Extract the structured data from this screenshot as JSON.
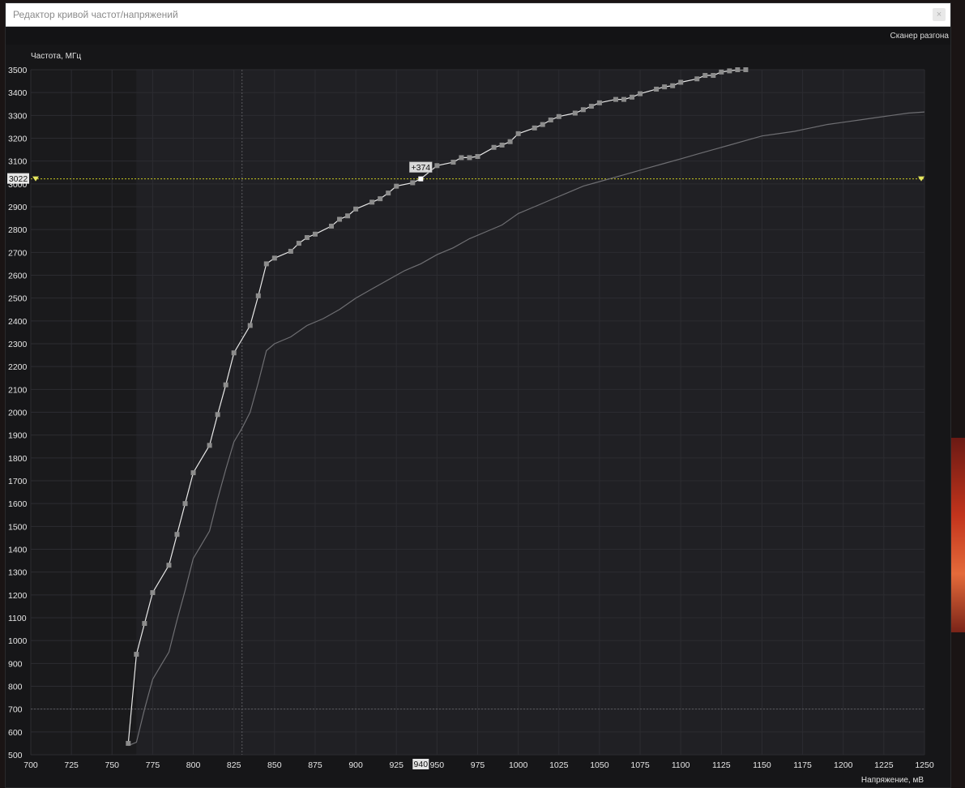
{
  "window": {
    "title": "Редактор кривой частот/напряжений",
    "close_label": "×"
  },
  "toolbar": {
    "scanner_label": "Сканер разгона"
  },
  "chart_data": {
    "type": "line",
    "ylabel": "Частота, МГц",
    "xlabel": "Напряжение, мВ",
    "xlim": [
      700,
      1250
    ],
    "ylim": [
      500,
      3500
    ],
    "x_ticks": [
      700,
      725,
      750,
      775,
      800,
      825,
      850,
      875,
      900,
      925,
      950,
      975,
      1000,
      1025,
      1050,
      1075,
      1100,
      1125,
      1150,
      1175,
      1200,
      1225,
      1250
    ],
    "y_ticks": [
      500,
      600,
      700,
      800,
      900,
      1000,
      1100,
      1200,
      1300,
      1400,
      1500,
      1600,
      1700,
      1800,
      1900,
      2000,
      2100,
      2200,
      2300,
      2400,
      2500,
      2600,
      2700,
      2800,
      2900,
      3000,
      3100,
      3200,
      3300,
      3400,
      3500
    ],
    "grid": true,
    "locked_region_x_max": 765,
    "reference_line_x": 830,
    "reference_line_y": 700,
    "current_frequency": 3022,
    "current_frequency_label": "3022",
    "selected_voltage": 940,
    "selected_voltage_label": "940",
    "offset_label": "+374",
    "colors": {
      "edited_curve": "#e8e8e8",
      "default_curve": "#6e6e72",
      "markers": "#8c8c8c",
      "selected_marker": "#ffffff",
      "frequency_line": "#c8c820",
      "plot_bg": "#202024",
      "locked_bg": "#1a1a1c"
    },
    "series": [
      {
        "role": "edited",
        "x": [
          760,
          765,
          770,
          775,
          785,
          790,
          795,
          800,
          810,
          815,
          820,
          825,
          835,
          840,
          845,
          850,
          860,
          865,
          870,
          875,
          885,
          890,
          895,
          900,
          910,
          915,
          920,
          925,
          935,
          940,
          950,
          960,
          965,
          970,
          975,
          985,
          990,
          995,
          1000,
          1010,
          1015,
          1020,
          1025,
          1035,
          1040,
          1045,
          1050,
          1060,
          1065,
          1070,
          1075,
          1085,
          1090,
          1095,
          1100,
          1110,
          1115,
          1120,
          1125,
          1130,
          1135,
          1140
        ],
        "y": [
          550,
          940,
          1075,
          1210,
          1330,
          1465,
          1600,
          1735,
          1855,
          1990,
          2120,
          2260,
          2380,
          2510,
          2650,
          2675,
          2705,
          2740,
          2765,
          2780,
          2815,
          2845,
          2860,
          2890,
          2920,
          2935,
          2960,
          2990,
          3005,
          3022,
          3080,
          3095,
          3115,
          3115,
          3120,
          3160,
          3170,
          3185,
          3220,
          3245,
          3260,
          3280,
          3295,
          3310,
          3325,
          3340,
          3355,
          3370,
          3370,
          3380,
          3395,
          3415,
          3425,
          3430,
          3445,
          3460,
          3475,
          3475,
          3490,
          3495,
          3500,
          3500
        ]
      },
      {
        "role": "default",
        "x": [
          760,
          765,
          770,
          775,
          780,
          785,
          790,
          795,
          800,
          805,
          810,
          815,
          820,
          825,
          830,
          835,
          840,
          845,
          850,
          860,
          870,
          880,
          890,
          900,
          910,
          920,
          930,
          940,
          950,
          960,
          970,
          980,
          990,
          1000,
          1010,
          1020,
          1030,
          1040,
          1050,
          1060,
          1070,
          1080,
          1090,
          1100,
          1110,
          1120,
          1130,
          1140,
          1150,
          1160,
          1170,
          1180,
          1190,
          1200,
          1210,
          1220,
          1230,
          1240,
          1250
        ],
        "y": [
          540,
          555,
          700,
          830,
          890,
          950,
          1090,
          1220,
          1360,
          1420,
          1480,
          1620,
          1750,
          1870,
          1930,
          2000,
          2130,
          2270,
          2300,
          2330,
          2380,
          2410,
          2450,
          2500,
          2540,
          2580,
          2620,
          2650,
          2690,
          2720,
          2760,
          2790,
          2820,
          2870,
          2900,
          2930,
          2960,
          2990,
          3010,
          3030,
          3050,
          3070,
          3090,
          3110,
          3130,
          3150,
          3170,
          3190,
          3210,
          3220,
          3230,
          3245,
          3260,
          3270,
          3280,
          3290,
          3300,
          3310,
          3315
        ]
      }
    ]
  }
}
